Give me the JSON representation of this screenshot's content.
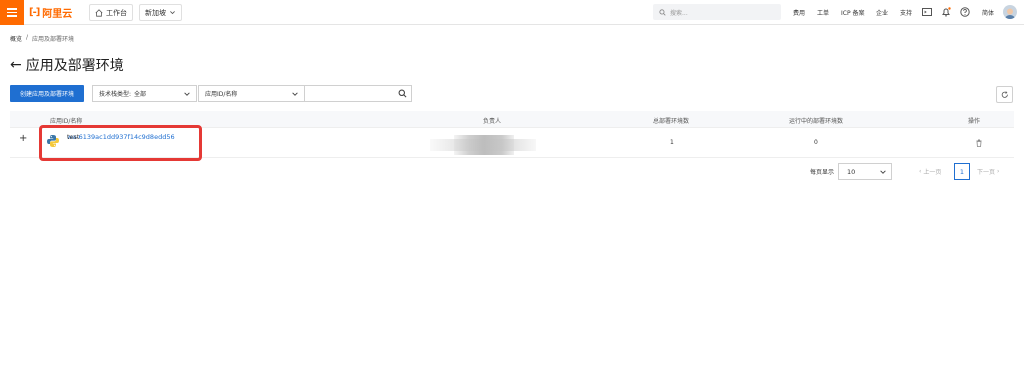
{
  "topbar": {
    "logo_mark": "[-]",
    "logo_text": "阿里云",
    "workbench": "工作台",
    "region": "新加坡",
    "search_placeholder": "搜索...",
    "links": [
      "费用",
      "工单",
      "ICP 备案",
      "企业",
      "支持"
    ],
    "lang": "简体"
  },
  "breadcrumb": {
    "home": "概览",
    "sep": "/",
    "current": "应用及部署环境"
  },
  "page": {
    "title": "应用及部署环境",
    "back_arrow": "←"
  },
  "toolbar": {
    "create_label": "创建应用及部署环境",
    "tech_stack_label": "技术栈类型:",
    "tech_stack_value": "全部",
    "search_type": "应用ID/名称",
    "search_value": ""
  },
  "table": {
    "headers": [
      "应用ID/名称",
      "负责人",
      "总部署环境数",
      "运行中的部署环境数",
      "操作"
    ],
    "rows": [
      {
        "expand": "+",
        "app_id": "wa-6139ac1dd937f14c9d8edd56",
        "app_name": "test",
        "owner": "",
        "total_envs": "1",
        "running_envs": "0"
      }
    ]
  },
  "pagination": {
    "per_page_label": "每页显示",
    "per_page_value": "10",
    "prev": "上一页",
    "current": "1",
    "next": "下一页"
  },
  "colors": {
    "brand": "#ff6a00",
    "primary": "#1f6fd1",
    "highlight": "#e53935"
  },
  "icons": [
    "menu-icon",
    "home-icon",
    "chevron-down-icon",
    "search-icon",
    "terminal-icon",
    "bell-icon",
    "help-icon",
    "refresh-icon",
    "python-icon",
    "trash-icon"
  ]
}
